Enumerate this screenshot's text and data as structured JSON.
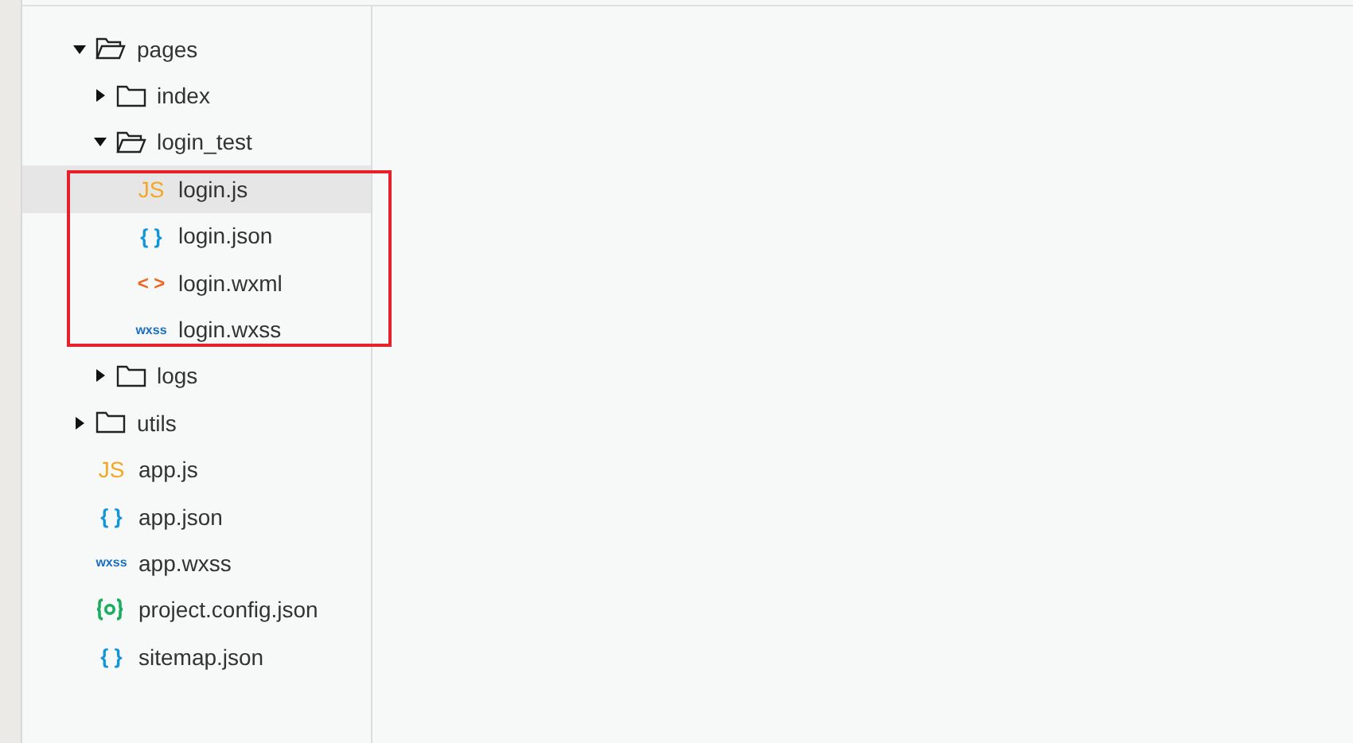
{
  "tree": [
    {
      "kind": "folder",
      "name": "pages",
      "expanded": true,
      "selected": false,
      "children": [
        {
          "kind": "folder",
          "name": "index",
          "expanded": false,
          "selected": false
        },
        {
          "kind": "folder",
          "name": "login_test",
          "expanded": true,
          "selected": false,
          "children": [
            {
              "kind": "js",
              "icon": "JS",
              "name": "login.js",
              "selected": true
            },
            {
              "kind": "json",
              "icon": "{ }",
              "name": "login.json",
              "selected": false
            },
            {
              "kind": "wxml",
              "icon": "< >",
              "name": "login.wxml",
              "selected": false
            },
            {
              "kind": "wxss",
              "icon": "wxss",
              "name": "login.wxss",
              "selected": false
            }
          ]
        },
        {
          "kind": "folder",
          "name": "logs",
          "expanded": false,
          "selected": false
        }
      ]
    },
    {
      "kind": "folder",
      "name": "utils",
      "expanded": false,
      "selected": false
    },
    {
      "kind": "js",
      "icon": "JS",
      "name": "app.js",
      "selected": false
    },
    {
      "kind": "json",
      "icon": "{ }",
      "name": "app.json",
      "selected": false
    },
    {
      "kind": "wxss",
      "icon": "wxss",
      "name": "app.wxss",
      "selected": false
    },
    {
      "kind": "config",
      "name": "project.config.json",
      "selected": false
    },
    {
      "kind": "json",
      "icon": "{ }",
      "name": "sitemap.json",
      "selected": false
    }
  ]
}
